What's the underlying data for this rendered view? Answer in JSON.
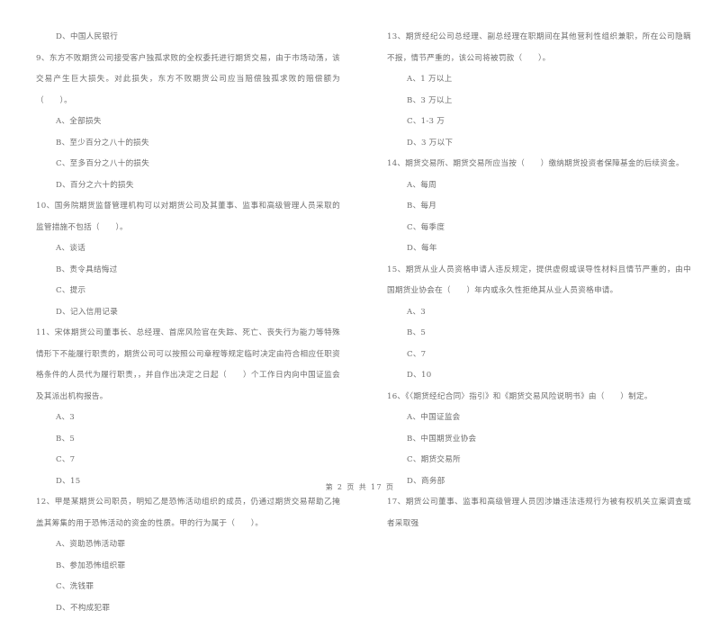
{
  "document": {
    "type": "exam-paper",
    "footer": "第 2 页 共 17 页",
    "page_number": "2",
    "total_pages": "17",
    "text_color": "#585858",
    "background_color": "#ffffff"
  },
  "columns": {
    "left": {
      "orphan_option": "D、中国人民银行",
      "questions": [
        {
          "number": "9",
          "stem": "9、东方不败期货公司接受客户独孤求败的全权委托进行期货交易，由于市场动荡，该交易产生巨大损失。对此损失，东方不败期货公司应当赔偿独孤求败的赔偿额为（　　）。",
          "options": [
            "A、全部损失",
            "B、至少百分之八十的损失",
            "C、至多百分之八十的损失",
            "D、百分之六十的损失"
          ]
        },
        {
          "number": "10",
          "stem": "10、国务院期货监督管理机构可以对期货公司及其董事、监事和高级管理人员采取的监管措施不包括（　　）。",
          "options": [
            "A、谈话",
            "B、责令具结悔过",
            "C、提示",
            "D、记入信用记录"
          ]
        },
        {
          "number": "11",
          "stem": "11、宋体期货公司董事长、总经理、首席风险官在失踪、死亡、丧失行为能力等特殊情形下不能履行职责的，期货公司可以按照公司章程等规定临时决定由符合相应任职资格条件的人员代为履行职责，，并自作出决定之日起（　　）个工作日内向中国证监会及其派出机构报告。",
          "options": [
            "A、3",
            "B、5",
            "C、7",
            "D、15"
          ]
        },
        {
          "number": "12",
          "stem": "12、甲是某期货公司职员，明知乙是恐怖活动组织的成员，仍通过期货交易帮助乙掩盖其筹集的用于恐怖活动的资金的性质。甲的行为属于（　　）。",
          "options": [
            "A、资助恐怖活动罪",
            "B、参加恐怖组织罪",
            "C、洗钱罪",
            "D、不构成犯罪"
          ]
        }
      ]
    },
    "right": {
      "questions": [
        {
          "number": "13",
          "stem": "13、期货经纪公司总经理、副总经理在职期间在其他营利性组织兼职，所在公司隐瞒不报，情节严重的，该公司将被罚款（　　）。",
          "options": [
            "A、1 万以上",
            "B、3 万以上",
            "C、1-3 万",
            "D、3 万以下"
          ]
        },
        {
          "number": "14",
          "stem": "14、期货交易所、期货交易所应当按（　　）缴纳期货投资者保障基金的后续资金。",
          "options": [
            "A、每周",
            "B、每月",
            "C、每季度",
            "D、每年"
          ]
        },
        {
          "number": "15",
          "stem": "15、期货从业人员资格申请人违反规定，提供虚假或误导性材料且情节严重的，由中国期货业协会在（　　）年内或永久性拒绝其从业人员资格申请。",
          "options": [
            "A、3",
            "B、5",
            "C、7",
            "D、10"
          ]
        },
        {
          "number": "16",
          "stem": "16、《〈期货经纪合同〉指引》和《期货交易风险说明书》由（　　）制定。",
          "options": [
            "A、中国证监会",
            "B、中国期货业协会",
            "C、期货交易所",
            "D、商务部"
          ]
        },
        {
          "number": "17",
          "stem": "17、期货公司董事、监事和高级管理人员因涉嫌违法违规行为被有权机关立案调查或者采取强",
          "options": []
        }
      ]
    }
  }
}
